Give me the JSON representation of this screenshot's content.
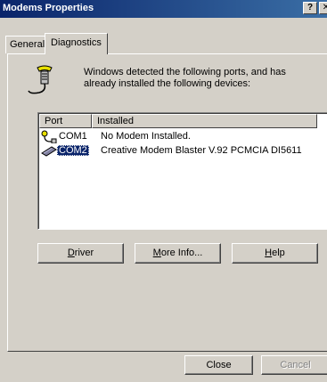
{
  "window": {
    "title": "Modems Properties",
    "help_glyph": "?",
    "close_glyph": "✕"
  },
  "tabs": [
    {
      "label": "General",
      "active": false
    },
    {
      "label": "Diagnostics",
      "active": true
    }
  ],
  "diagnostics": {
    "description_line1": "Windows detected the following ports, and has",
    "description_line2": "already installed the following devices:",
    "icon": "modem-icon",
    "list": {
      "columns": [
        "Port",
        "Installed"
      ],
      "rows": [
        {
          "port": "COM1",
          "installed": "No Modem Installed.",
          "icon": "serial-port-icon",
          "selected": false
        },
        {
          "port": "COM2",
          "installed": "Creative Modem Blaster V.92 PCMCIA DI5611",
          "icon": "pcmcia-card-icon",
          "selected": true
        }
      ]
    },
    "buttons": {
      "driver_first": "D",
      "driver_rest": "river",
      "more_first": "M",
      "more_rest": "ore Info...",
      "help_first": "H",
      "help_rest": "elp"
    }
  },
  "footer": {
    "close_label": "Close",
    "cancel_label": "Cancel"
  },
  "colors": {
    "titlebar_start": "#0a246a",
    "titlebar_end": "#3a6ea5",
    "face": "#d4d0c8",
    "selection": "#0a246a"
  }
}
